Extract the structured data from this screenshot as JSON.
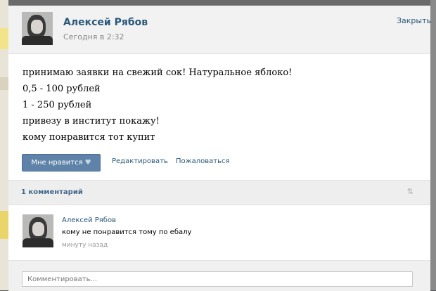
{
  "post": {
    "author": "Алексей Рябов",
    "time": "Сегодня в 2:32",
    "close_label": "Закрыть",
    "lines": [
      "принимаю заявки на свежий сок! Натуральное яблоко!",
      "0,5 - 100 рублей",
      "1 - 250 рублей",
      "привезу в институт покажу!",
      "кому понравится тот купит"
    ],
    "like_label": "Мне нравится",
    "like_icon": "heart-icon",
    "edit_label": "Редактировать",
    "report_label": "Пожаловаться"
  },
  "comments": {
    "count_label": "1 комментарий",
    "sort_icon": "sort-arrows-icon",
    "items": [
      {
        "author": "Алексей Рябов",
        "text": "кому не понравится тому по ебалу",
        "time": "минуту назад"
      }
    ],
    "input_placeholder": "Комментировать..."
  },
  "colors": {
    "link": "#2b587a",
    "button": "#5e82a8",
    "header_bg": "#f2f2f2",
    "overlay": "#595a5b"
  }
}
